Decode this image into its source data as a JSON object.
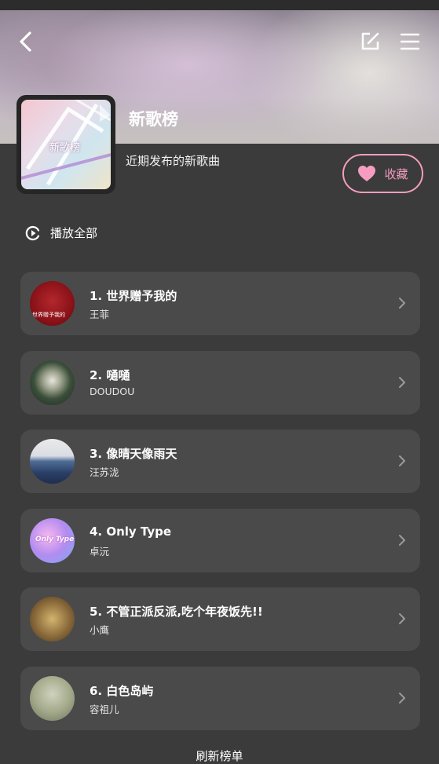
{
  "header": {
    "back_icon": "chevron-left-icon",
    "edit_icon": "edit-icon",
    "menu_icon": "menu-icon"
  },
  "playlist": {
    "cover_text": "新歌榜",
    "title": "新歌榜",
    "description": "近期发布的新歌曲",
    "favorite_label": "收藏",
    "accent_color": "#f59dc0"
  },
  "actions": {
    "play_all_label": "播放全部"
  },
  "songs": [
    {
      "title": "1. 世界赠予我的",
      "artist": "王菲",
      "thumb_text": "世界赠予我的"
    },
    {
      "title": "2. 嗵嗵",
      "artist": "DOUDOU"
    },
    {
      "title": "3. 像晴天像雨天",
      "artist": "汪苏泷"
    },
    {
      "title": "4. Only Type",
      "artist": "卓沅",
      "thumb_text": "Only Type"
    },
    {
      "title": "5. 不管正派反派,吃个年夜饭先!!",
      "artist": "小鹰"
    },
    {
      "title": "6. 白色岛屿",
      "artist": "容祖儿"
    }
  ],
  "footer": {
    "refresh_label": "刷新榜单"
  }
}
